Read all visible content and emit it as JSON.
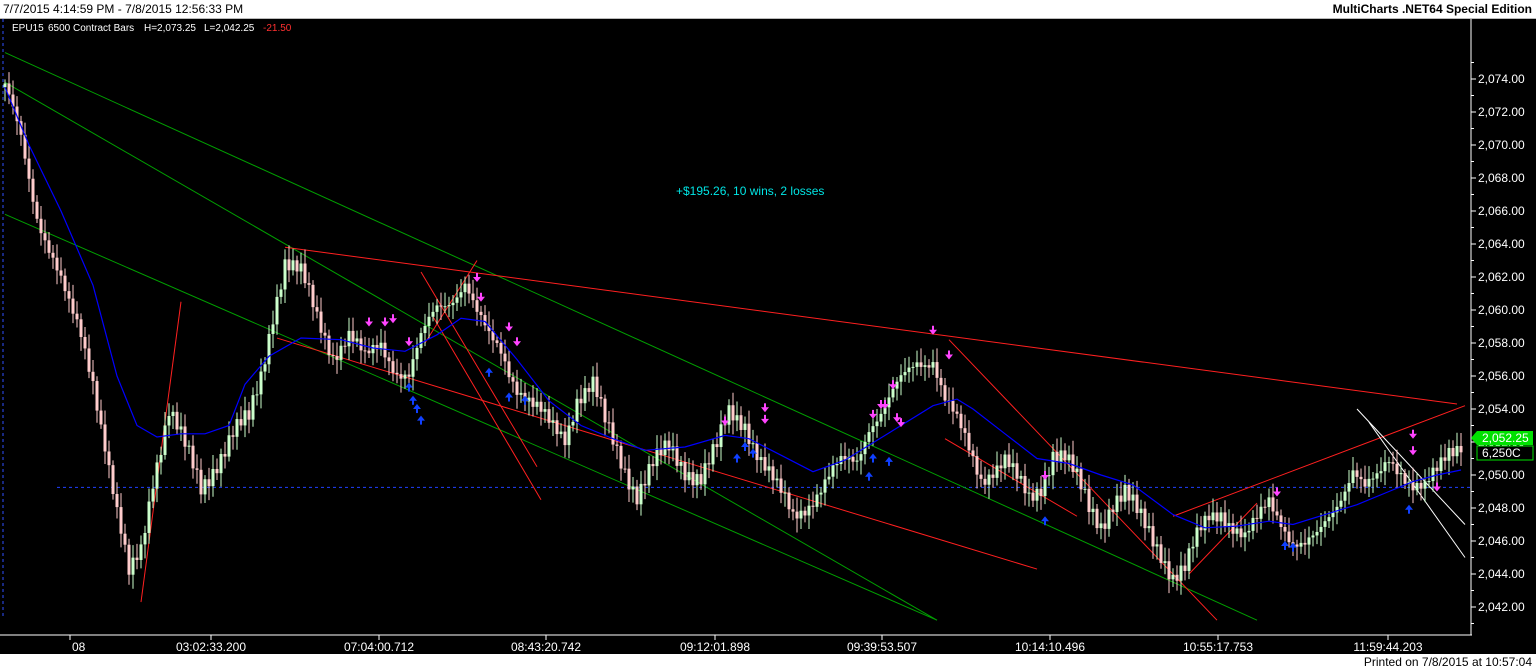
{
  "header": {
    "date_range": "7/7/2015 4:14:59 PM - 7/8/2015 12:56:33 PM",
    "app_title": "MultiCharts .NET64 Special Edition"
  },
  "info_bar": {
    "symbol": "EPU15",
    "bars": "6500 Contract Bars",
    "high": "H=2,073.25",
    "low": "L=2,042.25",
    "change": "-21.50"
  },
  "annotation": "+$195.26, 10 wins, 2 losses",
  "price_tag": {
    "last": "2,052.25",
    "countdown": "6,250C"
  },
  "footer": {
    "printed": "Printed on 7/8/2015 at 10:57:04"
  },
  "colors": {
    "background": "#000000",
    "bull_candle": "#ccffcc",
    "bear_candle": "#ffcccc",
    "moving_average": "#0000ff",
    "green_channel": "#00a000",
    "red_trendline": "#ff2020",
    "sell_arrow": "#ff44ff",
    "buy_arrow": "#1040ff",
    "annotation_text": "#00e5e5",
    "price_tag_bg": "#00e000"
  },
  "chart_data": {
    "type": "candlestick",
    "symbol": "EPU15",
    "y_axis": {
      "ticks": [
        "2,042.00",
        "2,044.00",
        "2,046.00",
        "2,048.00",
        "2,050.00",
        "2,052.00",
        "2,054.00",
        "2,056.00",
        "2,058.00",
        "2,060.00",
        "2,062.00",
        "2,064.00",
        "2,066.00",
        "2,068.00",
        "2,070.00",
        "2,072.00",
        "2,074.00"
      ],
      "range": [
        2041.2,
        2076.5
      ]
    },
    "x_axis": {
      "ticks": [
        "08",
        "03:02:33.200",
        "07:04:00.712",
        "08:43:20.742",
        "09:12:01.898",
        "09:39:53.507",
        "10:14:10.496",
        "10:55:17.753",
        "11:59:44.203"
      ]
    },
    "reference_line_price": 2049.25,
    "anchors": [
      [
        0,
        2073.2
      ],
      [
        4,
        2070.5
      ],
      [
        8,
        2066
      ],
      [
        12,
        2063
      ],
      [
        16,
        2060
      ],
      [
        19,
        2058.5
      ],
      [
        22,
        2056
      ],
      [
        25,
        2052
      ],
      [
        28,
        2047.5
      ],
      [
        31,
        2043.7
      ],
      [
        34,
        2045.5
      ],
      [
        37,
        2050
      ],
      [
        41,
        2054
      ],
      [
        45,
        2051.5
      ],
      [
        49,
        2049.2
      ],
      [
        53,
        2051
      ],
      [
        57,
        2052.5
      ],
      [
        61,
        2053.2
      ],
      [
        64,
        2056
      ],
      [
        67,
        2060
      ],
      [
        70,
        2063
      ],
      [
        74,
        2062
      ],
      [
        78,
        2059.5
      ],
      [
        82,
        2057.5
      ],
      [
        86,
        2058.5
      ],
      [
        90,
        2056.8
      ],
      [
        94,
        2058
      ],
      [
        98,
        2056.5
      ],
      [
        101,
        2056
      ],
      [
        104,
        2058
      ],
      [
        108,
        2060.2
      ],
      [
        112,
        2061
      ],
      [
        115,
        2061.7
      ],
      [
        118,
        2059.5
      ],
      [
        121,
        2058.2
      ],
      [
        124,
        2057.7
      ],
      [
        128,
        2055.5
      ],
      [
        132,
        2054
      ],
      [
        136,
        2053
      ],
      [
        140,
        2052.5
      ],
      [
        143,
        2054.8
      ],
      [
        147,
        2055.3
      ],
      [
        150,
        2053
      ],
      [
        154,
        2051
      ],
      [
        158,
        2049
      ],
      [
        162,
        2050.5
      ],
      [
        166,
        2051.5
      ],
      [
        170,
        2050.5
      ],
      [
        174,
        2050
      ],
      [
        178,
        2051.5
      ],
      [
        181,
        2053.6
      ],
      [
        185,
        2053.3
      ],
      [
        189,
        2051
      ],
      [
        193,
        2049
      ],
      [
        197,
        2047.5
      ],
      [
        201,
        2048.5
      ],
      [
        205,
        2049.5
      ],
      [
        209,
        2050.5
      ],
      [
        213,
        2051
      ],
      [
        216,
        2053.2
      ],
      [
        220,
        2054
      ],
      [
        224,
        2055.5
      ],
      [
        228,
        2057
      ],
      [
        232,
        2057.2
      ],
      [
        235,
        2054.5
      ],
      [
        238,
        2053
      ],
      [
        241,
        2051.5
      ],
      [
        244,
        2050
      ],
      [
        247,
        2050.5
      ],
      [
        250,
        2050.8
      ],
      [
        253,
        2049.5
      ],
      [
        256,
        2048.5
      ],
      [
        259,
        2049.5
      ],
      [
        262,
        2051.5
      ],
      [
        265,
        2051
      ],
      [
        268,
        2049.5
      ],
      [
        271,
        2048
      ],
      [
        274,
        2047.2
      ],
      [
        277,
        2048.5
      ],
      [
        280,
        2048.8
      ],
      [
        283,
        2047.5
      ],
      [
        286,
        2046.5
      ],
      [
        289,
        2045.5
      ],
      [
        292,
        2044
      ],
      [
        295,
        2044.2
      ],
      [
        298,
        2046
      ],
      [
        301,
        2047.5
      ],
      [
        304,
        2048
      ],
      [
        307,
        2047
      ],
      [
        310,
        2046
      ],
      [
        313,
        2047
      ],
      [
        316,
        2048.5
      ],
      [
        319,
        2047.5
      ],
      [
        322,
        2046
      ],
      [
        325,
        2045.5
      ],
      [
        328,
        2046
      ],
      [
        331,
        2047.5
      ],
      [
        334,
        2049
      ],
      [
        337,
        2050.5
      ],
      [
        340,
        2049
      ],
      [
        343,
        2049.5
      ],
      [
        346,
        2051
      ],
      [
        349,
        2050.5
      ],
      [
        352,
        2049.5
      ],
      [
        355,
        2049
      ],
      [
        358,
        2050
      ],
      [
        361,
        2051.5
      ],
      [
        364,
        2052.2
      ]
    ],
    "moving_average_anchors": [
      [
        0,
        2073.5
      ],
      [
        6,
        2070
      ],
      [
        14,
        2066
      ],
      [
        22,
        2061.5
      ],
      [
        28,
        2056
      ],
      [
        33,
        2053
      ],
      [
        38,
        2052.3
      ],
      [
        44,
        2052.5
      ],
      [
        50,
        2052.5
      ],
      [
        56,
        2053
      ],
      [
        60,
        2055.5
      ],
      [
        66,
        2057.2
      ],
      [
        74,
        2058.3
      ],
      [
        84,
        2058.2
      ],
      [
        92,
        2057.7
      ],
      [
        100,
        2057.5
      ],
      [
        108,
        2058.5
      ],
      [
        114,
        2059.5
      ],
      [
        120,
        2059.3
      ],
      [
        128,
        2057
      ],
      [
        136,
        2054.5
      ],
      [
        144,
        2053
      ],
      [
        152,
        2052.2
      ],
      [
        160,
        2051.5
      ],
      [
        170,
        2051.7
      ],
      [
        180,
        2052.4
      ],
      [
        186,
        2052.2
      ],
      [
        194,
        2051.2
      ],
      [
        202,
        2050.2
      ],
      [
        210,
        2050.9
      ],
      [
        216,
        2051.8
      ],
      [
        224,
        2053
      ],
      [
        232,
        2054.2
      ],
      [
        238,
        2054.6
      ],
      [
        242,
        2054
      ],
      [
        250,
        2052.5
      ],
      [
        258,
        2051
      ],
      [
        266,
        2050.7
      ],
      [
        274,
        2050
      ],
      [
        282,
        2049.4
      ],
      [
        292,
        2047.6
      ],
      [
        300,
        2046.8
      ],
      [
        308,
        2046.9
      ],
      [
        316,
        2047.2
      ],
      [
        322,
        2047
      ],
      [
        330,
        2047.6
      ],
      [
        338,
        2048.2
      ],
      [
        346,
        2049
      ],
      [
        352,
        2049.6
      ],
      [
        358,
        2050
      ],
      [
        364,
        2050.3
      ]
    ],
    "green_channel_lines": [
      {
        "from": [
          0,
          2073.8
        ],
        "to": [
          233,
          2041.2
        ]
      },
      {
        "from": [
          0,
          2065.8
        ],
        "to": [
          233,
          2041.2
        ]
      },
      {
        "from": [
          0,
          2075.6
        ],
        "to": [
          313,
          2041.2
        ]
      }
    ],
    "red_trend_lines": [
      {
        "from": [
          70,
          2063.8
        ],
        "to": [
          363,
          2054.3
        ]
      },
      {
        "from": [
          68,
          2058.3
        ],
        "to": [
          258,
          2044.3
        ]
      },
      {
        "from": [
          104,
          2062.3
        ],
        "to": [
          133,
          2050.5
        ]
      },
      {
        "from": [
          107,
          2059.6
        ],
        "to": [
          134,
          2048.5
        ]
      },
      {
        "from": [
          118,
          2063
        ],
        "to": [
          105,
          2058
        ]
      },
      {
        "from": [
          236,
          2058.2
        ],
        "to": [
          303,
          2041.2
        ]
      },
      {
        "from": [
          235,
          2052.2
        ],
        "to": [
          268,
          2047.5
        ]
      },
      {
        "from": [
          292,
          2047.5
        ],
        "to": [
          365,
          2054.2
        ]
      },
      {
        "from": [
          296,
          2044
        ],
        "to": [
          313,
          2048.3
        ]
      },
      {
        "from": [
          34,
          2042.3
        ],
        "to": [
          44,
          2060.5
        ]
      }
    ],
    "white_lines": [
      {
        "from": [
          338,
          2054
        ],
        "to": [
          365,
          2047
        ]
      },
      {
        "from": [
          341,
          2053.2
        ],
        "to": [
          365,
          2045
        ]
      }
    ],
    "sell_signals": [
      [
        91,
        2059
      ],
      [
        95,
        2059
      ],
      [
        97,
        2059.2
      ],
      [
        101,
        2057.8
      ],
      [
        118,
        2061.7
      ],
      [
        119,
        2060.5
      ],
      [
        126,
        2058.7
      ],
      [
        128,
        2057.8
      ],
      [
        180,
        2053
      ],
      [
        190,
        2053.8
      ],
      [
        190,
        2053.1
      ],
      [
        217,
        2053.4
      ],
      [
        219,
        2054
      ],
      [
        220,
        2054
      ],
      [
        222,
        2055.2
      ],
      [
        224,
        2052.9
      ],
      [
        223,
        2053.2
      ],
      [
        232,
        2058.5
      ],
      [
        236,
        2057
      ],
      [
        260,
        2049.7
      ],
      [
        318,
        2048.7
      ],
      [
        352,
        2052.2
      ],
      [
        352,
        2051.2
      ],
      [
        358,
        2049
      ]
    ],
    "buy_signals": [
      [
        101,
        2055.6
      ],
      [
        102,
        2054.8
      ],
      [
        104,
        2053.6
      ],
      [
        103,
        2054.3
      ],
      [
        121,
        2056.5
      ],
      [
        126,
        2055
      ],
      [
        130,
        2054.8
      ],
      [
        183,
        2051.3
      ],
      [
        185,
        2052
      ],
      [
        187,
        2051.6
      ],
      [
        216,
        2050.2
      ],
      [
        217,
        2051.3
      ],
      [
        221,
        2051.1
      ],
      [
        260,
        2047.5
      ],
      [
        320,
        2046
      ],
      [
        322,
        2045.9
      ],
      [
        351,
        2048.2
      ]
    ]
  }
}
